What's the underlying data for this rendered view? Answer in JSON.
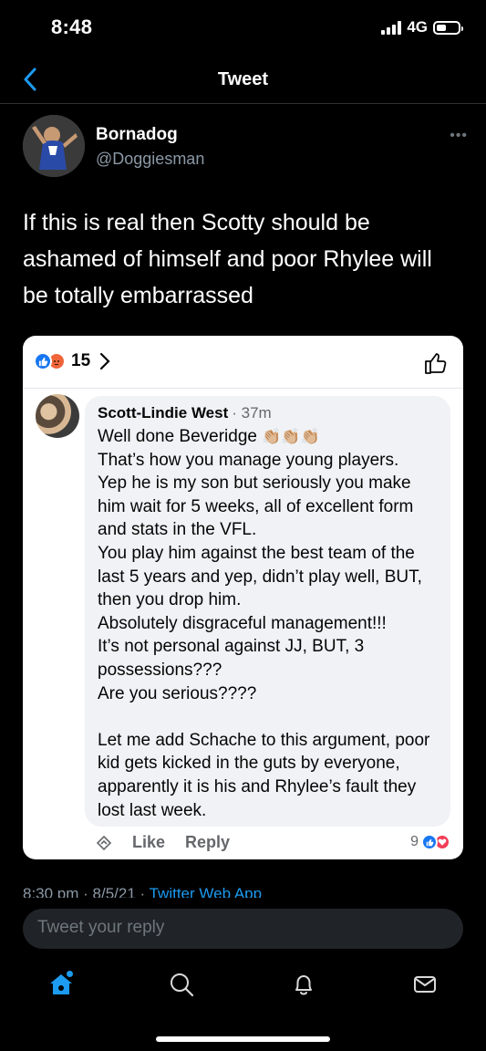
{
  "status_bar": {
    "time": "8:48",
    "network": "4G"
  },
  "nav": {
    "title": "Tweet"
  },
  "tweet": {
    "author_name": "Bornadog",
    "author_handle": "@Doggiesman",
    "text": "If this is real then Scotty should be ashamed of himself and poor Rhylee will be totally embarrassed",
    "meta": "8:30 pm · 8/5/21 · ",
    "meta_via": "Twitter Web App"
  },
  "embed": {
    "reaction_count": "15",
    "comment": {
      "author": "Scott-Lindie West",
      "time": "· 37m",
      "first_line": "Well done Beveridge ",
      "clap_emoji": "👏🏼👏🏼👏🏼",
      "body": "That’s how you manage young players.\nYep he is my son but seriously you make him wait for 5 weeks, all of excellent form and stats in the VFL.\nYou play him against the best team of the last 5 years and yep, didn’t play well, BUT, then you drop him.\nAbsolutely disgraceful management!!!\nIt’s not personal against JJ, BUT, 3 possessions???\nAre you serious????\n\nLet me add Schache to this argument, poor kid gets kicked in the guts by everyone, apparently it is his and Rhylee’s fault they lost last week."
    },
    "actions": {
      "like": "Like",
      "reply": "Reply"
    },
    "comment_reaction_count": "9"
  },
  "reply_bar": {
    "placeholder": "Tweet your reply"
  },
  "tabs": [
    "home-icon",
    "search-icon",
    "bell-icon",
    "mail-icon"
  ],
  "colors": {
    "accent": "#1d9bf0",
    "fb_blue": "#1877f2",
    "fb_angry": "#f0653a",
    "fb_love": "#f33e58"
  }
}
